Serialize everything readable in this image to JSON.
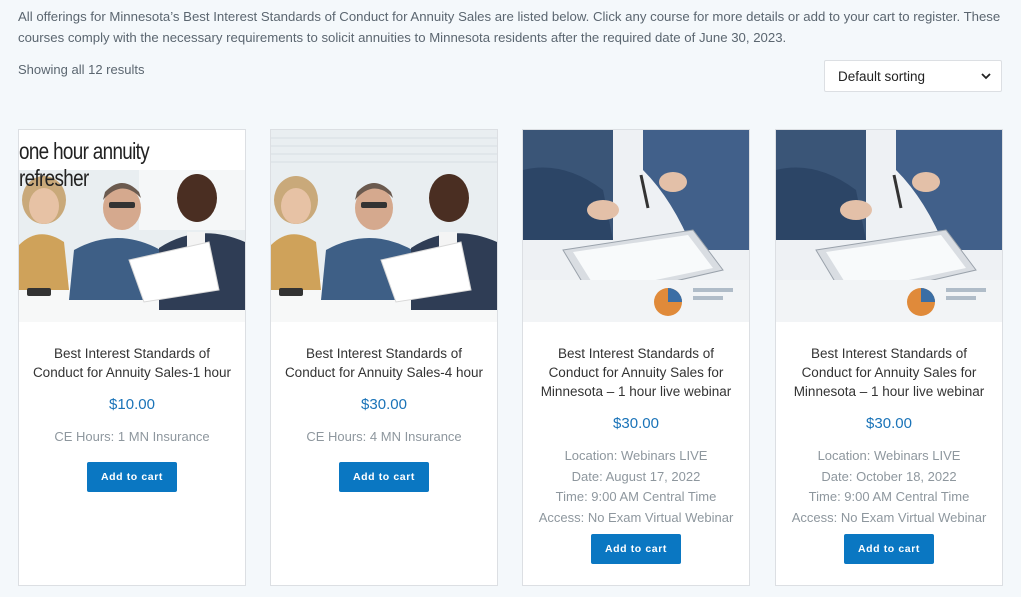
{
  "intro": "All offerings for Minnesota’s Best Interest Standards of Conduct for Annuity Sales are listed below. Click any course for more details or add to your cart to register. These courses comply with the necessary requirements to solicit annuities to Minnesota residents after the required date of June 30, 2023.",
  "results_count": "Showing all 12 results",
  "sort": {
    "selected": "Default sorting"
  },
  "products": [
    {
      "image_caption": "one hour annuity refresher",
      "image_alt": "meeting-photo",
      "title": "Best Interest Standards of Conduct for Annuity Sales-1 hour",
      "price": "$10.00",
      "details": [
        "CE Hours: 1 MN Insurance"
      ],
      "button": "Add to cart"
    },
    {
      "image_caption": "",
      "title": "Best Interest Standards of Conduct for Annuity Sales-4 hour",
      "price": "$30.00",
      "details": [
        "CE Hours: 4 MN Insurance"
      ],
      "button": "Add to cart"
    },
    {
      "image_caption": "",
      "title": "Best Interest Standards of Conduct for Annuity Sales for Minnesota – 1 hour live webinar",
      "price": "$30.00",
      "details": [
        "Location: Webinars LIVE",
        "Date: August 17, 2022",
        "Time: 9:00 AM Central Time",
        "Access: No Exam Virtual Webinar"
      ],
      "button": "Add to cart"
    },
    {
      "image_caption": "",
      "title": "Best Interest Standards of Conduct for Annuity Sales for Minnesota – 1 hour live webinar",
      "price": "$30.00",
      "details": [
        "Location: Webinars LIVE",
        "Date: October 18, 2022",
        "Time: 9:00 AM Central Time",
        "Access: No Exam Virtual Webinar"
      ],
      "button": "Add to cart"
    }
  ]
}
